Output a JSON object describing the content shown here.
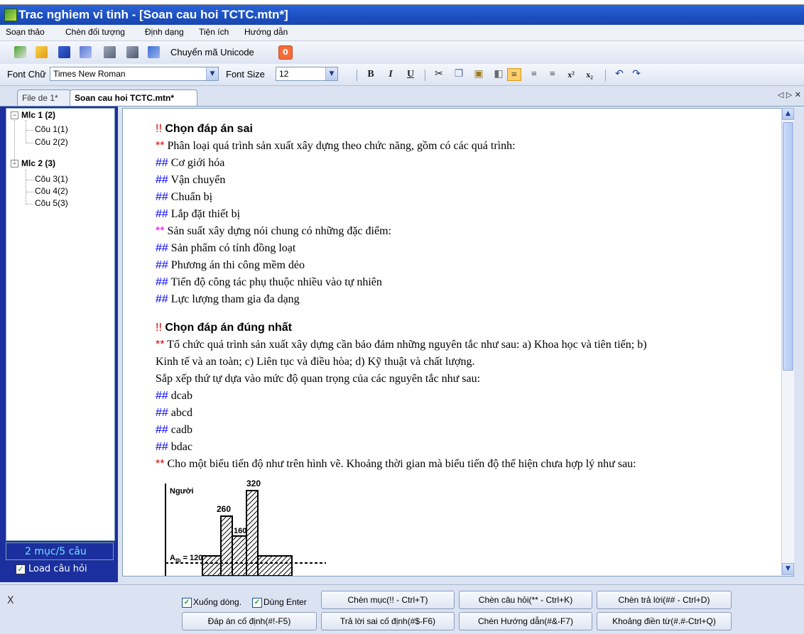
{
  "window": {
    "title": "Trac nghiem vi tinh - [Soan cau hoi TCTC.mtn*]"
  },
  "menu": [
    "Soạn thảo",
    "Chèn đối tượng",
    "Định dạng",
    "Tiện ích",
    "Hướng dẫn"
  ],
  "toolbar": {
    "icons": [
      "check-icon",
      "open-folder-icon",
      "save-icon",
      "export-icon",
      "print-preview-icon",
      "print-icon",
      "save-as-icon"
    ],
    "unicode_label": "Chuyển mã Unicode",
    "stop_label": "0"
  },
  "format_bar": {
    "font_label": "Font Chữ",
    "font_value": "Times New Roman",
    "size_label": "Font Size",
    "size_value": "12",
    "bold": "B",
    "italic": "I",
    "underline": "U",
    "superscript": "x²",
    "subscript": "x₂"
  },
  "tabs": [
    {
      "label": "File de 1*"
    },
    {
      "label": "Soan cau hoi TCTC.mtn*"
    }
  ],
  "tab_nav": "◁ ▷ ✕",
  "tree": {
    "groups": [
      {
        "label": "Mlc 1 (2)",
        "items": [
          "Cõu 1(1)",
          "Cõu 2(2)"
        ]
      },
      {
        "label": "Mlc 2 (3)",
        "items": [
          "Cõu 3(1)",
          "Cõu 4(2)",
          "Cõu 5(3)"
        ]
      }
    ]
  },
  "status": {
    "count": "2 mục/5 câu",
    "load_label": "Load câu hỏi"
  },
  "editor": {
    "lines": [
      {
        "mark": "!!",
        "text": " Chọn đáp án sai",
        "type": "heading"
      },
      {
        "mark": "**",
        "text": " Phân loại quá trình sản xuất xây dựng theo chức năng, gồm có các quá trình:",
        "type": "question"
      },
      {
        "mark": "##",
        "text": " Cơ giới hóa",
        "type": "answer"
      },
      {
        "mark": "##",
        "text": " Vận chuyển",
        "type": "answer"
      },
      {
        "mark": "##",
        "text": " Chuẩn bị",
        "type": "answer"
      },
      {
        "mark": "##",
        "text": " Lắp đặt thiết bị",
        "type": "answer"
      },
      {
        "mark": "**",
        "text": " Sản suất xây dựng nói chung có những đặc điểm:",
        "type": "question2"
      },
      {
        "mark": "##",
        "text": " Sản phẩm có tính đồng loạt",
        "type": "answer"
      },
      {
        "mark": "##",
        "text": " Phương án thi công mềm dẻo",
        "type": "answer"
      },
      {
        "mark": "##",
        "text": " Tiến độ công tác phụ thuộc nhiều vào tự nhiên",
        "type": "answer"
      },
      {
        "mark": "##",
        "text": " Lực lượng tham gia đa dạng",
        "type": "answer"
      },
      {
        "mark": "!!",
        "text": " Chọn đáp án đúng nhất",
        "type": "heading"
      },
      {
        "mark": "**",
        "text": " Tổ chức quá trình sản xuất xây dựng cần bảo đảm những nguyên tắc như sau: a) Khoa học và tiên tiến;   b)",
        "type": "question"
      },
      {
        "mark": "",
        "text": "Kinh tế và an toàn;   c) Liên tục và điều hòa;   d) Kỹ thuật và chất lượng.",
        "type": "plain"
      },
      {
        "mark": "",
        "text": "Sắp xếp thứ tự dựa vào mức độ quan trọng của các nguyên tắc như sau:",
        "type": "plain"
      },
      {
        "mark": "##",
        "text": " dcab",
        "type": "answer"
      },
      {
        "mark": "##",
        "text": " abcd",
        "type": "answer"
      },
      {
        "mark": "##",
        "text": " cadb",
        "type": "answer"
      },
      {
        "mark": "##",
        "text": " bdac",
        "type": "answer"
      },
      {
        "mark": "**",
        "text": " Cho một biểu tiến độ như trên hình vẽ. Khoảng thời gian mà biểu tiến độ thể hiện chưa hợp lý như sau:",
        "type": "question"
      }
    ],
    "figure": {
      "ylabel": "Người",
      "labels": [
        "320",
        "260",
        "160"
      ],
      "baseline": "A"
    }
  },
  "bottom": {
    "close": "X",
    "check_newline": "Xuống dòng.",
    "check_enter": "Dùng Enter",
    "buttons": [
      "Chèn mục(!! - Ctrl+T)",
      "Chèn câu hỏi(** - Ctrl+K)",
      "Chèn trả lời(## - Ctrl+D)",
      "Đáp án cố định(#!-F5)",
      "Trả lời sai cố định(#$-F6)",
      "Chèn Hướng dẫn(#&-F7)",
      "Khoảng điền từ(#.#-Ctrl+Q)"
    ]
  },
  "colors": {
    "title": "#1c4fc0",
    "heading_mark": "#e00000",
    "answer_mark": "#0000ff",
    "question_mark": "#e00000",
    "question2_mark": "#e000e0",
    "panel": "#1c2f9e"
  }
}
